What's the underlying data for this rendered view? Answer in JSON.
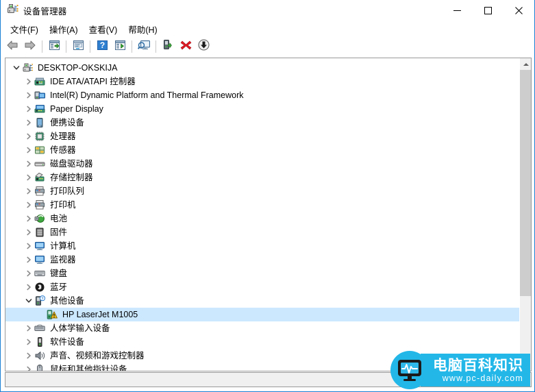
{
  "window": {
    "title": "设备管理器",
    "icon": "device-manager-icon",
    "controls": {
      "minimize": "–",
      "maximize": "□",
      "close": "✕"
    }
  },
  "menubar": {
    "items": [
      {
        "label": "文件(F)",
        "name": "menu-file"
      },
      {
        "label": "操作(A)",
        "name": "menu-action"
      },
      {
        "label": "查看(V)",
        "name": "menu-view"
      },
      {
        "label": "帮助(H)",
        "name": "menu-help"
      }
    ]
  },
  "toolbar": {
    "buttons": [
      {
        "name": "back-button",
        "icon": "arrow-left-icon",
        "type": "arrow-left"
      },
      {
        "name": "forward-button",
        "icon": "arrow-right-icon",
        "type": "arrow-right"
      },
      {
        "name": "separator-1",
        "icon": "separator",
        "type": "sep"
      },
      {
        "name": "properties-button",
        "icon": "properties-icon",
        "type": "properties"
      },
      {
        "name": "separator-2",
        "icon": "separator",
        "type": "sep"
      },
      {
        "name": "update-driver-button",
        "icon": "update-driver-icon",
        "type": "update"
      },
      {
        "name": "separator-3",
        "icon": "separator",
        "type": "sep"
      },
      {
        "name": "help-button",
        "icon": "help-icon",
        "type": "help"
      },
      {
        "name": "show-hidden-button",
        "icon": "show-hidden-icon",
        "type": "showhidden"
      },
      {
        "name": "separator-4",
        "icon": "separator",
        "type": "sep"
      },
      {
        "name": "scan-hardware-button",
        "icon": "scan-monitor-icon",
        "type": "scan"
      },
      {
        "name": "separator-5",
        "icon": "separator",
        "type": "sep"
      },
      {
        "name": "add-legacy-hardware-button",
        "icon": "add-device-icon",
        "type": "adddev"
      },
      {
        "name": "uninstall-device-button",
        "icon": "red-x-icon",
        "type": "redx"
      },
      {
        "name": "update-download-button",
        "icon": "download-arrow-icon",
        "type": "download"
      }
    ]
  },
  "tree": {
    "root": {
      "label": "DESKTOP-OKSKIJA",
      "icon": "computer-root-icon",
      "expanded": true,
      "level": 0
    },
    "nodes": [
      {
        "label": "IDE ATA/ATAPI 控制器",
        "icon": "ide-controller-icon",
        "expanded": false,
        "level": 1,
        "selected": false
      },
      {
        "label": "Intel(R) Dynamic Platform and Thermal Framework",
        "icon": "thermal-framework-icon",
        "expanded": false,
        "level": 1,
        "selected": false
      },
      {
        "label": "Paper Display",
        "icon": "display-adapter-icon",
        "expanded": false,
        "level": 1,
        "selected": false
      },
      {
        "label": "便携设备",
        "icon": "portable-device-icon",
        "expanded": false,
        "level": 1,
        "selected": false
      },
      {
        "label": "处理器",
        "icon": "processor-icon",
        "expanded": false,
        "level": 1,
        "selected": false
      },
      {
        "label": "传感器",
        "icon": "sensor-icon",
        "expanded": false,
        "level": 1,
        "selected": false
      },
      {
        "label": "磁盘驱动器",
        "icon": "disk-drive-icon",
        "expanded": false,
        "level": 1,
        "selected": false
      },
      {
        "label": "存储控制器",
        "icon": "storage-controller-icon",
        "expanded": false,
        "level": 1,
        "selected": false
      },
      {
        "label": "打印队列",
        "icon": "print-queue-icon",
        "expanded": false,
        "level": 1,
        "selected": false
      },
      {
        "label": "打印机",
        "icon": "printer-icon",
        "expanded": false,
        "level": 1,
        "selected": false
      },
      {
        "label": "电池",
        "icon": "battery-icon",
        "expanded": false,
        "level": 1,
        "selected": false
      },
      {
        "label": "固件",
        "icon": "firmware-icon",
        "expanded": false,
        "level": 1,
        "selected": false
      },
      {
        "label": "计算机",
        "icon": "computer-icon",
        "expanded": false,
        "level": 1,
        "selected": false
      },
      {
        "label": "监视器",
        "icon": "monitor-icon",
        "expanded": false,
        "level": 1,
        "selected": false
      },
      {
        "label": "键盘",
        "icon": "keyboard-icon",
        "expanded": false,
        "level": 1,
        "selected": false
      },
      {
        "label": "蓝牙",
        "icon": "bluetooth-icon",
        "expanded": false,
        "level": 1,
        "selected": false
      },
      {
        "label": "其他设备",
        "icon": "other-devices-icon",
        "expanded": true,
        "level": 1,
        "selected": false
      },
      {
        "label": "HP LaserJet M1005",
        "icon": "warning-device-icon",
        "expanded": null,
        "level": 2,
        "selected": true
      },
      {
        "label": "人体学输入设备",
        "icon": "hid-icon",
        "expanded": false,
        "level": 1,
        "selected": false
      },
      {
        "label": "软件设备",
        "icon": "software-device-icon",
        "expanded": false,
        "level": 1,
        "selected": false
      },
      {
        "label": "声音、视频和游戏控制器",
        "icon": "sound-video-game-icon",
        "expanded": false,
        "level": 1,
        "selected": false
      },
      {
        "label": "鼠标和其他指针设备",
        "icon": "mouse-icon",
        "expanded": false,
        "level": 1,
        "selected": false
      }
    ]
  },
  "scrollbar": {
    "up_arrow": "▲",
    "down_arrow": "▼"
  },
  "statusbar": {
    "text": ""
  },
  "watermark": {
    "cn_text": "电脑百科知识",
    "url": "www.pc-daily.com",
    "color": "#23b7e8"
  },
  "colors": {
    "window_border": "#1a7fd4",
    "selection": "#cce8ff",
    "panel_border": "#9a9a9a",
    "scroll_thumb": "#cdcdcd",
    "statusbar_bg": "#f0f0f0"
  }
}
